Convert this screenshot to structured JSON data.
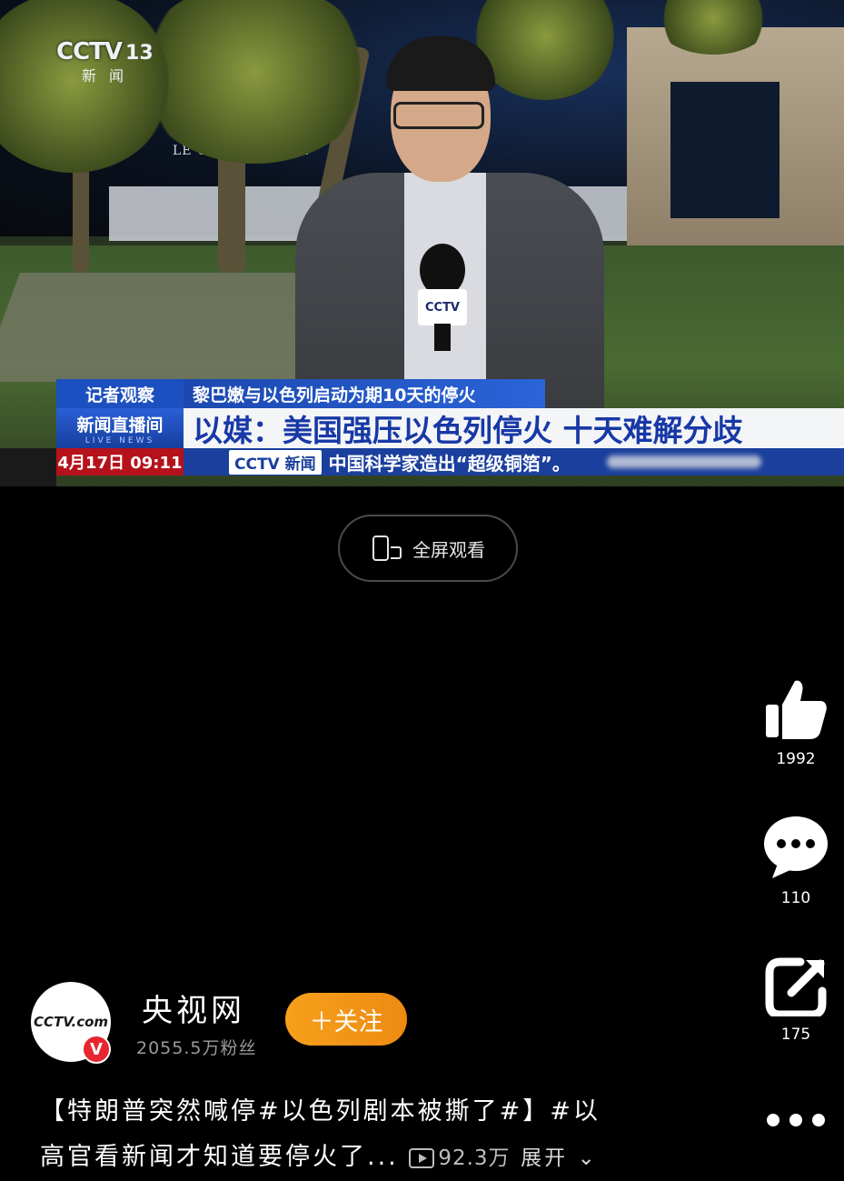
{
  "video": {
    "channel_logo": "CCTV",
    "channel_number": "13",
    "channel_sub": "新闻",
    "hotel_sign": "LE GRAND HOTEL",
    "mic_flag": "CCTV",
    "lower_third": {
      "tag": "记者观察",
      "kicker": "黎巴嫩与以色列启动为期10天的停火",
      "show_name": "新闻直播间",
      "show_sub": "LIVE NEWS",
      "headline": "以媒：美国强压以色列停火 十天难解分歧",
      "time": "4月17日 09:11",
      "ticker_brand": "CCTV 新闻",
      "ticker_text": "中国科学家造出“超级铜箔”。"
    }
  },
  "fullscreen_button": {
    "label": "全屏观看",
    "icon": "phone-rotate-icon"
  },
  "actions": {
    "like": {
      "icon": "thumbs-up-icon",
      "count": "1992"
    },
    "comment": {
      "icon": "comment-bubble-icon",
      "count": "110"
    },
    "share": {
      "icon": "share-arrow-icon",
      "count": "175"
    },
    "more": {
      "icon": "more-dots-icon"
    }
  },
  "author": {
    "avatar_text": "CCTV.com",
    "verified_badge": "V",
    "name": "央视网",
    "fans": "2055.5万粉丝",
    "follow_label": "＋关注"
  },
  "caption": {
    "line1": "【特朗普突然喊停#以色列剧本被撕了#】#以",
    "line2": "高官看新闻才知道要停火了...",
    "views": "92.3万",
    "expand": "展开"
  },
  "colors": {
    "follow_orange": "#f39418",
    "cctv_blue": "#1c4fbf",
    "time_red": "#b5121b",
    "verified_red": "#e8262f"
  }
}
